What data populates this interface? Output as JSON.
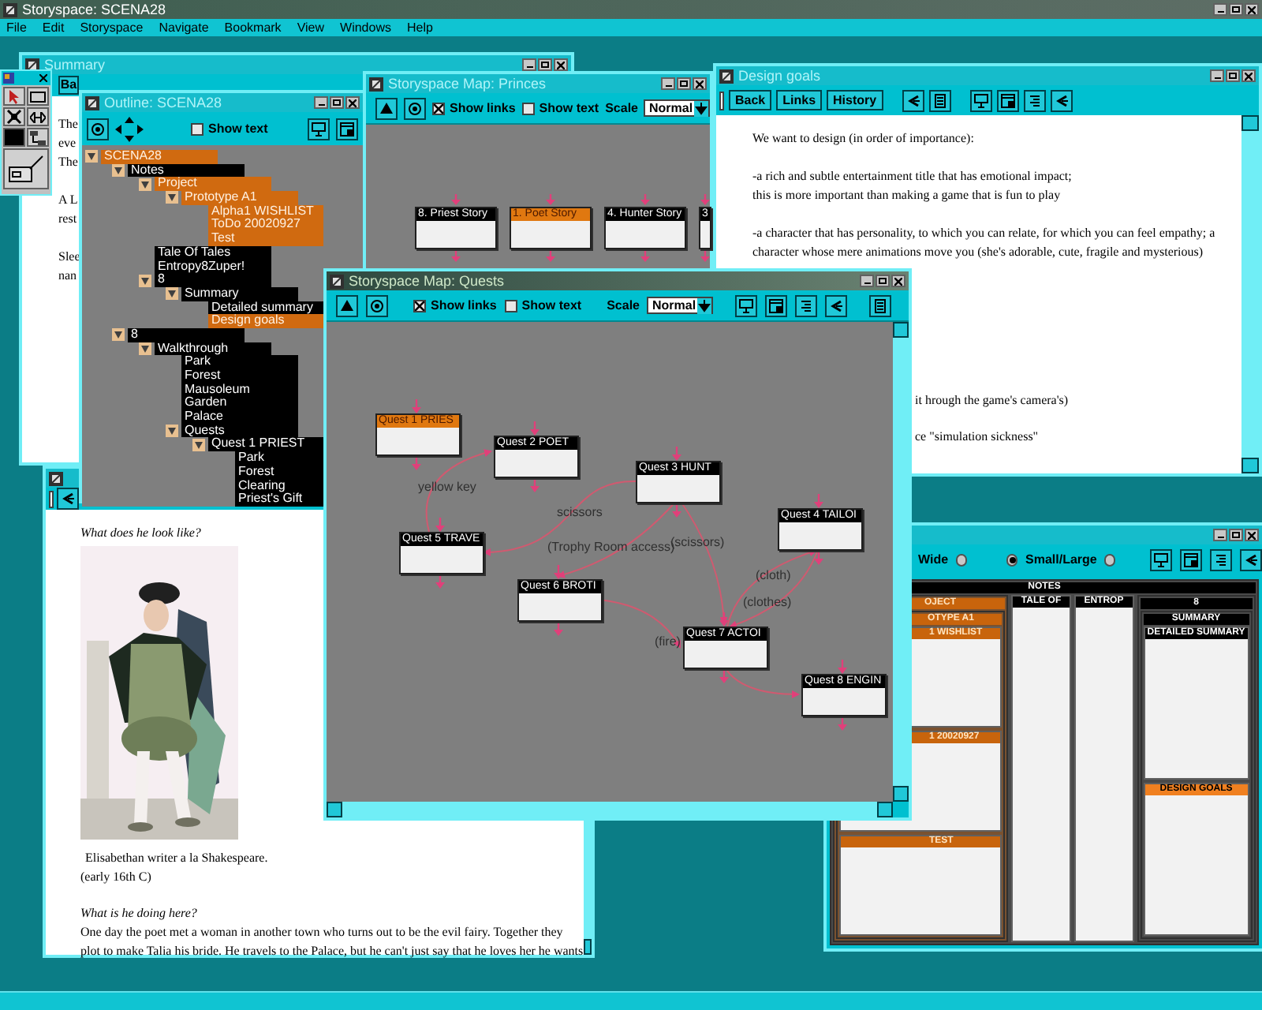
{
  "app": {
    "title": "Storyspace: SCENA28",
    "menu": [
      "File",
      "Edit",
      "Storyspace",
      "Navigate",
      "Bookmark",
      "View",
      "Windows",
      "Help"
    ]
  },
  "summary": {
    "title": "Summary",
    "back_button": "Ba",
    "paragraphs": [
      [
        "The",
        "eve",
        "The"
      ],
      [
        "A L",
        "rest"
      ],
      [
        "Slee",
        "nan"
      ]
    ]
  },
  "princes_map": {
    "title": "Storyspace Map: Princes",
    "show_links": {
      "label": "Show links",
      "checked": true
    },
    "show_text": {
      "label": "Show text",
      "checked": false
    },
    "scale_label": "Scale",
    "scale": "Normal",
    "nodes": [
      {
        "title": "8. Priest Story",
        "color": "#000000"
      },
      {
        "title": "1. Poet Story",
        "color": "#e07810"
      },
      {
        "title": "4. Hunter Story",
        "color": "#000000"
      },
      {
        "title": "3",
        "color": "#000000"
      }
    ]
  },
  "design_goals": {
    "title": "Design goals",
    "buttons": [
      "Back",
      "Links",
      "History"
    ],
    "paragraphs": [
      [
        "We want to design (in order of importance):"
      ],
      [
        "-a rich and subtle entertainment title that has emotional impact;",
        "this is more important than making a game that is fun to play"
      ],
      [
        "-a character that has personality, to which you can relate, for which you can feel empathy; a",
        "character whose mere animations move you (she's adorable, cute, fragile and mysterious)"
      ]
    ],
    "fragments": [
      "it hrough the game's camera's)",
      "ce \"simulation sickness\""
    ]
  },
  "treemap": {
    "options": [
      {
        "kind": "label",
        "text": "Wide"
      },
      {
        "kind": "radio",
        "selected": false
      },
      {
        "kind": "radio",
        "selected": true
      },
      {
        "kind": "label",
        "text": "Small/Large"
      },
      {
        "kind": "radio",
        "selected": false
      }
    ],
    "tree": {
      "label": "NOTES",
      "color": "#000000",
      "children": [
        {
          "label": "OJECT",
          "color": "#c8640c",
          "children": [
            {
              "label": "OTYPE A1",
              "color": "#c8640c",
              "children": [
                {
                  "label": "1 WISHLIST",
                  "color": "#c8640c"
                },
                {
                  "label": "1 20020927",
                  "color": "#c8640c"
                },
                {
                  "label": "TEST",
                  "color": "#c8640c"
                }
              ]
            }
          ]
        },
        {
          "label": "TALE OF",
          "color": "#000000"
        },
        {
          "label": "ENTROP",
          "color": "#000000"
        },
        {
          "label": "8",
          "color": "#000000",
          "children": [
            {
              "label": "SUMMARY",
              "color": "#000000",
              "children": [
                {
                  "label": "DETAILED SUMMARY",
                  "color": "#000000"
                },
                {
                  "label": "DESIGN GOALS",
                  "color": "#f08020"
                }
              ]
            }
          ]
        }
      ]
    }
  },
  "text_window": {
    "blocks": [
      {
        "kind": "question",
        "text": "What does he look like?"
      },
      {
        "kind": "picture"
      },
      {
        "kind": "caption",
        "lines": [
          "Elisabethan writer a la Shakespeare."
        ]
      },
      {
        "kind": "plain",
        "lines": [
          "(early 16th C)"
        ]
      },
      {
        "kind": "question",
        "text": "What is he doing here?"
      },
      {
        "kind": "plain",
        "lines": [
          "One day the poet met a woman in another town who turns out to be the evil fairy. Together they",
          "plot to make Talia his bride. He travels to the Palace, but he can't just say that he loves her he wants"
        ]
      }
    ]
  },
  "outline": {
    "title": "Outline: SCENA28",
    "show_text": {
      "label": "Show text",
      "checked": false
    },
    "tree": [
      {
        "label": "SCENA28",
        "color": "#d06a10",
        "children": [
          {
            "label": "Notes",
            "color": "#000000",
            "children": [
              {
                "label": "Project",
                "color": "#d06a10",
                "children": [
                  {
                    "label": "Prototype A1",
                    "color": "#d06a10",
                    "children": [
                      {
                        "label": "Alpha1 WISHLIST",
                        "color": "#d06a10"
                      },
                      {
                        "label": "ToDo 20020927",
                        "color": "#d06a10"
                      },
                      {
                        "label": "Test",
                        "color": "#d06a10"
                      }
                    ]
                  }
                ]
              },
              {
                "label": "Tale Of Tales",
                "color": "#000000"
              },
              {
                "label": "Entropy8Zuper!",
                "color": "#000000"
              },
              {
                "label": "8",
                "color": "#000000",
                "children": [
                  {
                    "label": "Summary",
                    "color": "#000000",
                    "children": [
                      {
                        "label": "Detailed summary",
                        "color": "#000000"
                      },
                      {
                        "label": "Design goals",
                        "color": "#d06a10"
                      }
                    ]
                  }
                ]
              }
            ]
          },
          {
            "label": "8",
            "color": "#000000",
            "children": [
              {
                "label": "Walkthrough",
                "color": "#000000",
                "children": [
                  {
                    "label": "Park",
                    "color": "#000000"
                  },
                  {
                    "label": "Forest",
                    "color": "#000000"
                  },
                  {
                    "label": "Mausoleum",
                    "color": "#000000"
                  },
                  {
                    "label": "Garden",
                    "color": "#000000"
                  },
                  {
                    "label": "Palace",
                    "color": "#000000"
                  },
                  {
                    "label": "Quests",
                    "color": "#000000",
                    "children": [
                      {
                        "label": "Quest 1 PRIEST",
                        "color": "#000000",
                        "children": [
                          {
                            "label": "Park",
                            "color": "#000000"
                          },
                          {
                            "label": "Forest",
                            "color": "#000000"
                          },
                          {
                            "label": "Clearing",
                            "color": "#000000"
                          },
                          {
                            "label": "Priest's Gift",
                            "color": "#000000"
                          }
                        ]
                      }
                    ]
                  }
                ]
              }
            ]
          }
        ]
      }
    ]
  },
  "quests_map": {
    "title": "Storyspace Map: Quests",
    "show_links": {
      "label": "Show links",
      "checked": true
    },
    "show_text": {
      "label": "Show text",
      "checked": false
    },
    "scale_label": "Scale",
    "scale": "Normal",
    "nodes": [
      {
        "title": "Quest 1 PRIES",
        "color": "#e07810"
      },
      {
        "title": "Quest 2 POET",
        "color": "#000000"
      },
      {
        "title": "Quest 3 HUNT",
        "color": "#000000"
      },
      {
        "title": "Quest 4 TAILOI",
        "color": "#000000"
      },
      {
        "title": "Quest 5 TRAVE",
        "color": "#000000"
      },
      {
        "title": "Quest 6 BROTI",
        "color": "#000000"
      },
      {
        "title": "Quest 7 ACTOI",
        "color": "#000000"
      },
      {
        "title": "Quest 8 ENGIN",
        "color": "#000000"
      }
    ],
    "link_labels": [
      "yellow key",
      "scissors",
      "(Trophy Room access)",
      "(scissors)",
      "(cloth)",
      "(clothes)",
      "(fire)"
    ]
  }
}
